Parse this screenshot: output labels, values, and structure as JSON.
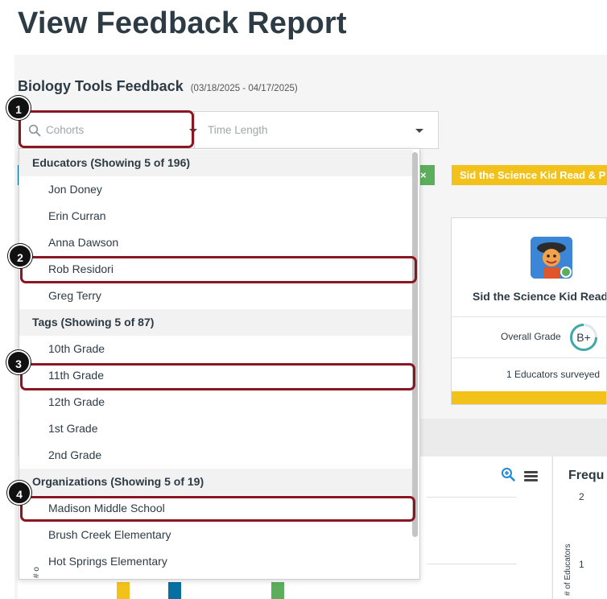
{
  "page": {
    "title": "View Feedback Report"
  },
  "report": {
    "title": "Biology Tools Feedback",
    "date_range": "(03/18/2025 - 04/17/2025)"
  },
  "filters": {
    "cohorts_placeholder": "Cohorts",
    "time_length_placeholder": "Time Length"
  },
  "chips": [
    {
      "label": "×",
      "color": "#5cae5c"
    },
    {
      "label": "Sid the Science Kid Read & P",
      "color": "#f3c21a"
    }
  ],
  "card": {
    "name": "Sid the Science Kid Read &",
    "grade_label": "Overall Grade",
    "grade": "B+",
    "surveyed": "1 Educators surveyed",
    "accent": "#f3c21a"
  },
  "chart": {
    "title": "Frequ",
    "ylabel": "# of Educators",
    "tick_2": "2",
    "tick_1": "1",
    "left_axis_fragment": "# o"
  },
  "dropdown": {
    "groups": [
      {
        "label": "Educators (Showing 5 of 196)",
        "items": [
          "Jon Doney",
          "Erin Curran",
          "Anna Dawson",
          "Rob Residori",
          "Greg Terry"
        ]
      },
      {
        "label": "Tags (Showing 5 of 87)",
        "items": [
          "10th Grade",
          "11th Grade",
          "12th Grade",
          "1st Grade",
          "2nd Grade"
        ]
      },
      {
        "label": "Organizations (Showing 5 of 19)",
        "items": [
          "Madison Middle School",
          "Brush Creek Elementary",
          "Hot Springs Elementary"
        ]
      }
    ]
  },
  "callouts": [
    "1",
    "2",
    "3",
    "4"
  ],
  "colors": {
    "highlight": "#8a1622",
    "title": "#2d3b45",
    "yellow": "#f3c21a",
    "green": "#5cae5c",
    "blue": "#0770a3"
  }
}
